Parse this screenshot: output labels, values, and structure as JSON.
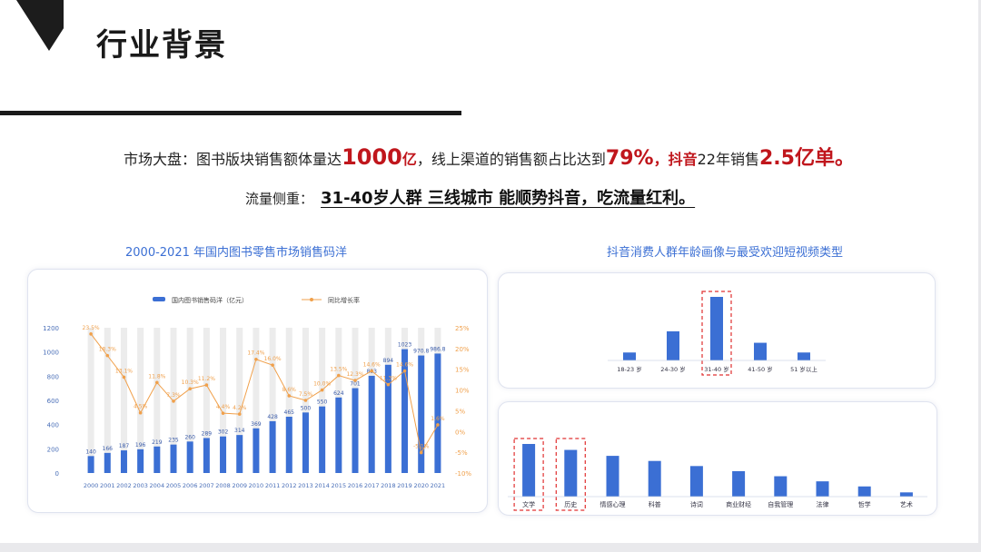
{
  "slide": {
    "title": "行业背景",
    "line1": {
      "p1": "市场大盘：图书版块销售额体量达",
      "v1": "1000",
      "u1": "亿",
      "p2": "，线上渠道的销售额占比达到",
      "v2": "79%",
      "p3": "，",
      "brand": "抖音",
      "p4": "22年销售",
      "v3": "2.5亿单。"
    },
    "line2": {
      "label": "流量侧重：",
      "text": "31-40岁人群 三线城市 能顺势抖音，吃流量红利。"
    }
  },
  "colors": {
    "bar": "#3b6fd4",
    "line": "#f0a04b",
    "bg_bar": "#ececec",
    "red": "#c0161c",
    "highlight": "#e03030"
  },
  "chart_data": [
    {
      "type": "bar",
      "title": "2000-2021 年国内图书零售市场销售码洋",
      "categories": [
        "2000",
        "2001",
        "2002",
        "2003",
        "2004",
        "2005",
        "2006",
        "2007",
        "2008",
        "2009",
        "2010",
        "2011",
        "2012",
        "2013",
        "2014",
        "2015",
        "2016",
        "2017",
        "2018",
        "2019",
        "2020",
        "2021"
      ],
      "series": [
        {
          "name": "国内图书销售码洋（亿元）",
          "type": "bar",
          "axis": "left",
          "values": [
            140,
            166,
            187,
            196,
            219,
            235,
            260,
            289,
            302,
            314,
            369,
            428,
            465,
            500,
            550,
            624,
            701,
            803,
            894,
            1023,
            970.8,
            986.8
          ],
          "labels": [
            "140",
            "166",
            "187",
            "196",
            "219",
            "235",
            "260",
            "289",
            "302",
            "314",
            "369",
            "428",
            "465",
            "500",
            "550",
            "624",
            "701",
            "803",
            "894",
            "1023",
            "970.8",
            "986.8"
          ]
        },
        {
          "name": "同比增长率",
          "type": "line",
          "axis": "right",
          "values": [
            23.5,
            18.3,
            13.1,
            4.5,
            11.8,
            7.3,
            10.3,
            11.2,
            4.4,
            4.2,
            17.4,
            16.0,
            8.6,
            7.5,
            10.0,
            13.5,
            12.3,
            14.6,
            11.3,
            14.6,
            -5.1,
            1.6
          ],
          "labels": [
            "23.5%",
            "18.3%",
            "13.1%",
            "4.5%",
            "11.8%",
            "7.3%",
            "10.3%",
            "11.2%",
            "4.4%",
            "4.2%",
            "17.4%",
            "16.0%",
            "8.6%",
            "7.5%",
            "10.0%",
            "13.5%",
            "12.3%",
            "14.6%",
            "11.3%",
            "14.6%",
            "-5.1%",
            "1.6%"
          ]
        }
      ],
      "ylim": [
        0,
        1200
      ],
      "yticks": [
        "0",
        "200",
        "400",
        "600",
        "800",
        "1000",
        "1200"
      ],
      "y2lim": [
        -10,
        25
      ],
      "y2ticks": [
        "-10%",
        "-5%",
        "0%",
        "5%",
        "10%",
        "15%",
        "20%",
        "25%"
      ],
      "legend": "top"
    },
    {
      "type": "bar",
      "title": "抖音消费人群年龄画像与最受欢迎短视频类型",
      "categories": [
        "18-23 岁",
        "24-30 岁",
        "31-40 岁",
        "41-50 岁",
        "51 岁以上"
      ],
      "values": [
        9,
        33,
        72,
        20,
        9
      ],
      "highlight": [
        "31-40 岁"
      ]
    },
    {
      "type": "bar",
      "categories": [
        "文学",
        "历史",
        "情感心理",
        "科普",
        "诗词",
        "商业财经",
        "自我管理",
        "法律",
        "哲学",
        "艺术"
      ],
      "values": [
        62,
        55,
        48,
        42,
        36,
        30,
        24,
        18,
        12,
        5
      ],
      "highlight": [
        "文学",
        "历史"
      ]
    }
  ]
}
